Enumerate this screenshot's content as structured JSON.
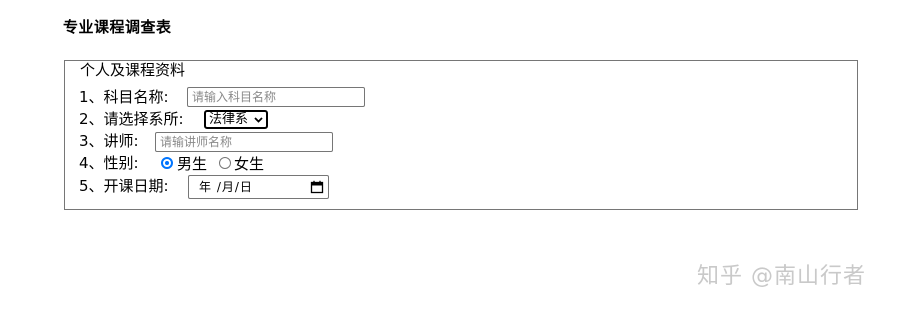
{
  "page_title": "专业课程调查表",
  "fieldset": {
    "legend": "个人及课程资料",
    "course_name": {
      "label": "1、科目名称:",
      "placeholder": "请输入科目名称",
      "value": ""
    },
    "department": {
      "label": "2、请选择系所:",
      "selected": "法律系"
    },
    "lecturer": {
      "label": "3、讲师:",
      "placeholder": "请输讲师名称",
      "value": ""
    },
    "gender": {
      "label": "4、性别:",
      "options": [
        {
          "label": "男生",
          "checked": true
        },
        {
          "label": "女生",
          "checked": false
        }
      ]
    },
    "start_date": {
      "label": "5、开课日期:",
      "display": "年 /月/日"
    }
  },
  "watermark": "知乎 @南山行者",
  "colors": {
    "radio_accent": "#0075ff",
    "border": "#767676",
    "watermark": "#c9c9c9"
  },
  "icons": {
    "select_chevron": "chevron-down-icon",
    "date_picker": "calendar-icon"
  }
}
